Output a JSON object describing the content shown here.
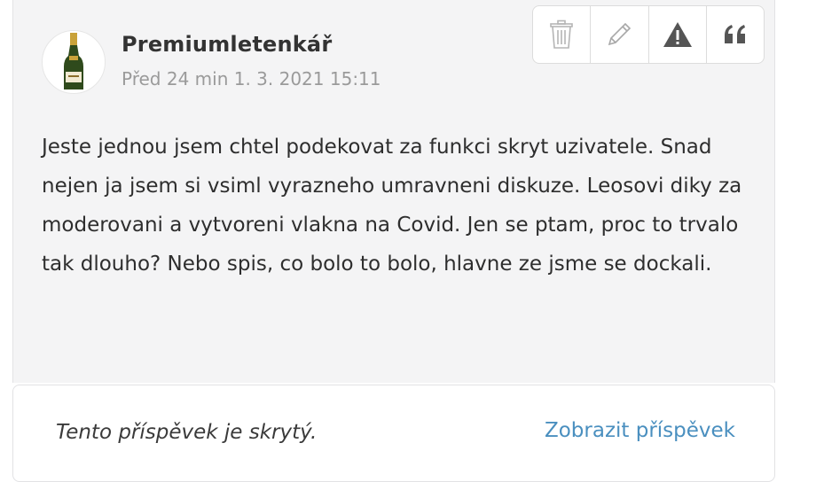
{
  "post": {
    "author": "Premiumletenkář",
    "timestamp": "Před 24 min 1. 3. 2021 15:11",
    "body": "Jeste jednou jsem chtel podekovat za funkci skryt uzivatele. Snad nejen ja jsem si vsiml vyrazneho umravneni diskuze. Leosovi diky za moderovani a vytvoreni vlakna na Covid. Jen se ptam, proc to trvalo tak dlouho? Nebo spis, co bolo to bolo, hlavne ze jsme se dockali.",
    "avatar_icon": "champagne-bottle-icon",
    "actions": [
      {
        "icon": "trash-icon"
      },
      {
        "icon": "pencil-icon"
      },
      {
        "icon": "warning-icon"
      },
      {
        "icon": "quote-icon"
      }
    ]
  },
  "hidden_notice": {
    "message": "Tento příspěvek je skrytý.",
    "show_link": "Zobrazit příspěvek"
  },
  "colors": {
    "link": "#4a8fbf",
    "post_background": "#f4f4f5",
    "muted_text": "#9a9a9a"
  }
}
